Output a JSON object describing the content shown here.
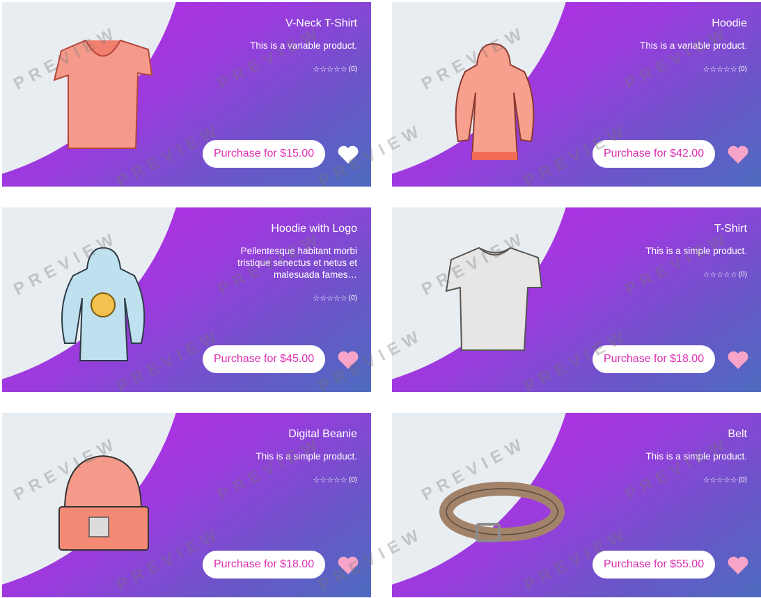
{
  "products": [
    {
      "title": "V-Neck T-Shirt",
      "description": "This is a variable product.",
      "rating_count": "(0)",
      "purchase_label": "Purchase for $15.00",
      "heart": "#ffffff",
      "icon": "vneck-tshirt-icon"
    },
    {
      "title": "Hoodie",
      "description": "This is a variable product.",
      "rating_count": "(0)",
      "purchase_label": "Purchase for $42.00",
      "heart": "#f7a4c8",
      "icon": "hoodie-icon"
    },
    {
      "title": "Hoodie with Logo",
      "description": "Pellentesque habitant morbi tristique senectus et netus et malesuada fames…",
      "rating_count": "(0)",
      "purchase_label": "Purchase for $45.00",
      "heart": "#f7a4c8",
      "icon": "hoodie-logo-icon"
    },
    {
      "title": "T-Shirt",
      "description": "This is a simple product.",
      "rating_count": "(0)",
      "purchase_label": "Purchase for $18.00",
      "heart": "#f7a4c8",
      "icon": "tshirt-icon"
    },
    {
      "title": "Digital Beanie",
      "description": "This is a simple product.",
      "rating_count": "(0)",
      "purchase_label": "Purchase for $18.00",
      "heart": "#f7a4c8",
      "icon": "beanie-icon"
    },
    {
      "title": "Belt",
      "description": "This is a simple product.",
      "rating_count": "(0)",
      "purchase_label": "Purchase for $55.00",
      "heart": "#f7a4c8",
      "icon": "belt-icon"
    }
  ],
  "stars": "☆☆☆☆☆",
  "watermark": "PREVIEW",
  "colors": {
    "gradient_start": "#c326e6",
    "gradient_end": "#4d6bbf",
    "button_text": "#dc2fb0",
    "curve": "#e8edf2"
  }
}
